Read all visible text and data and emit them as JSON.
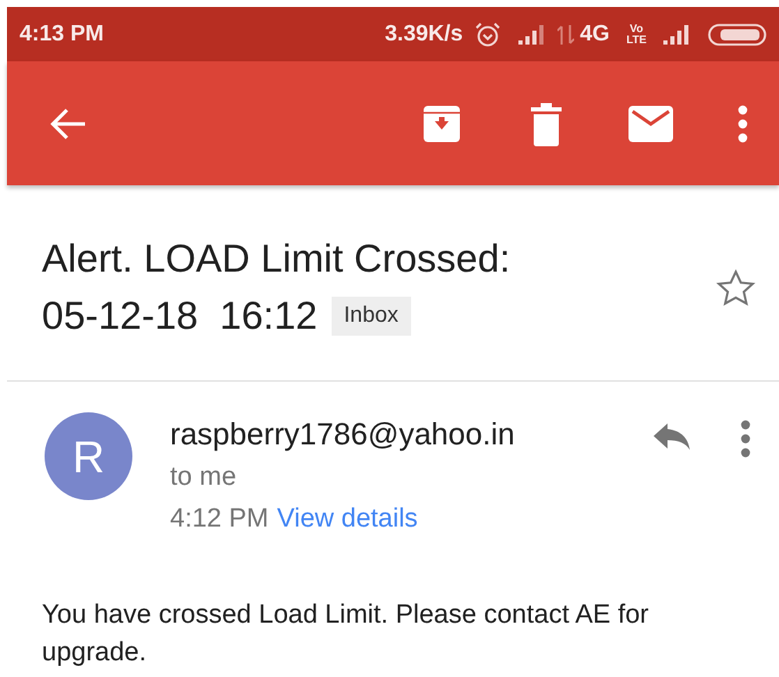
{
  "status_bar": {
    "time": "4:13 PM",
    "speed": "3.39K/s",
    "network": "4G",
    "volte_top": "Vo",
    "volte_bottom": "LTE"
  },
  "toolbar": {
    "actions": [
      {
        "kind": "archive"
      },
      {
        "kind": "delete"
      },
      {
        "kind": "mark-unread"
      },
      {
        "kind": "more"
      }
    ]
  },
  "subject": {
    "title_lines": [
      "Alert. LOAD Limit Crossed:",
      "05-12-18  16:12"
    ],
    "label": "Inbox",
    "starred": false
  },
  "message": {
    "avatar_letter": "R",
    "sender": "raspberry1786@yahoo.in",
    "recipient": "to me",
    "time": "4:12 PM",
    "details_link": "View details",
    "body": "You have crossed Load Limit. Please contact AE for upgrade."
  }
}
